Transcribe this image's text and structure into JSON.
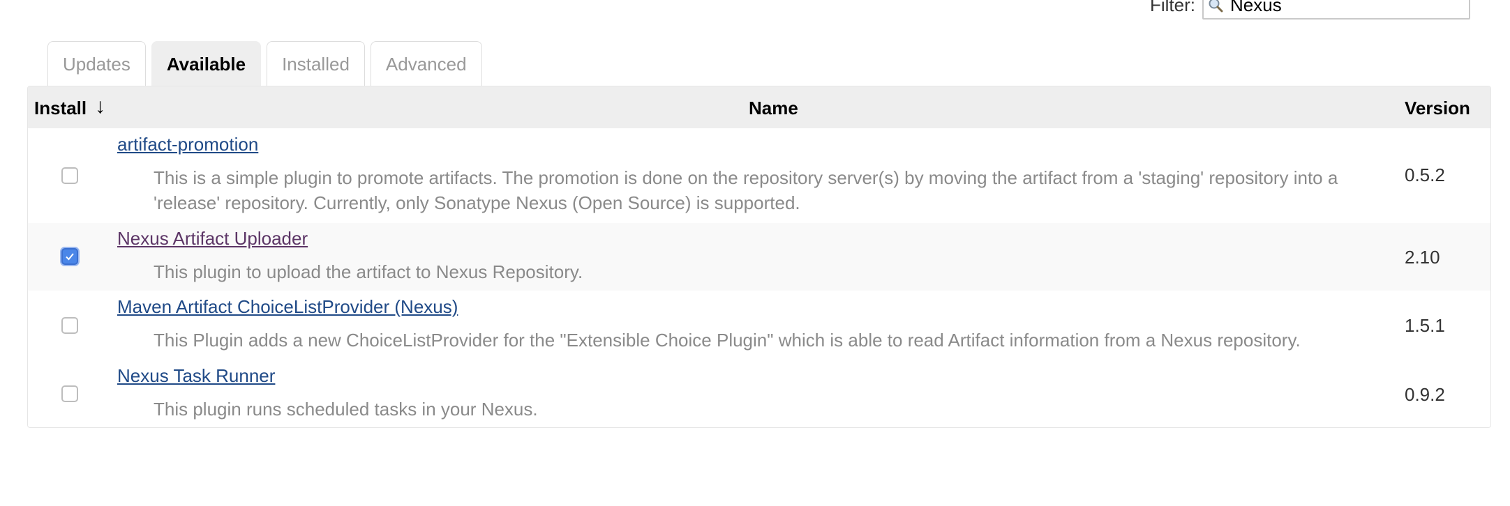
{
  "filter": {
    "label": "Filter:",
    "value": "Nexus"
  },
  "tabs": [
    {
      "label": "Updates",
      "active": false
    },
    {
      "label": "Available",
      "active": true
    },
    {
      "label": "Installed",
      "active": false
    },
    {
      "label": "Advanced",
      "active": false
    }
  ],
  "table": {
    "headers": {
      "install": "Install",
      "sort_indicator": "↓",
      "name": "Name",
      "version": "Version"
    },
    "rows": [
      {
        "checked": false,
        "name": "artifact-promotion",
        "description": "This is a simple plugin to promote artifacts. The promotion is done on the repository server(s) by moving the artifact from a 'staging' repository into a 'release' repository. Currently, only Sonatype Nexus (Open Source) is supported.",
        "version": "0.5.2"
      },
      {
        "checked": true,
        "name": "Nexus Artifact Uploader",
        "description": "This plugin to upload the artifact to Nexus Repository.",
        "version": "2.10"
      },
      {
        "checked": false,
        "name": "Maven Artifact ChoiceListProvider (Nexus)",
        "description": "This Plugin adds a new ChoiceListProvider for the \"Extensible Choice Plugin\" which is able to read Artifact information from a Nexus repository.",
        "version": "1.5.1"
      },
      {
        "checked": false,
        "name": "Nexus Task Runner",
        "description": "This plugin runs scheduled tasks in your Nexus.",
        "version": "0.9.2"
      }
    ]
  },
  "colors": {
    "link": "#204a87",
    "visited_link": "#5c3566",
    "checkbox_checked": "#4a86e8",
    "header_bg": "#eeeeee"
  }
}
